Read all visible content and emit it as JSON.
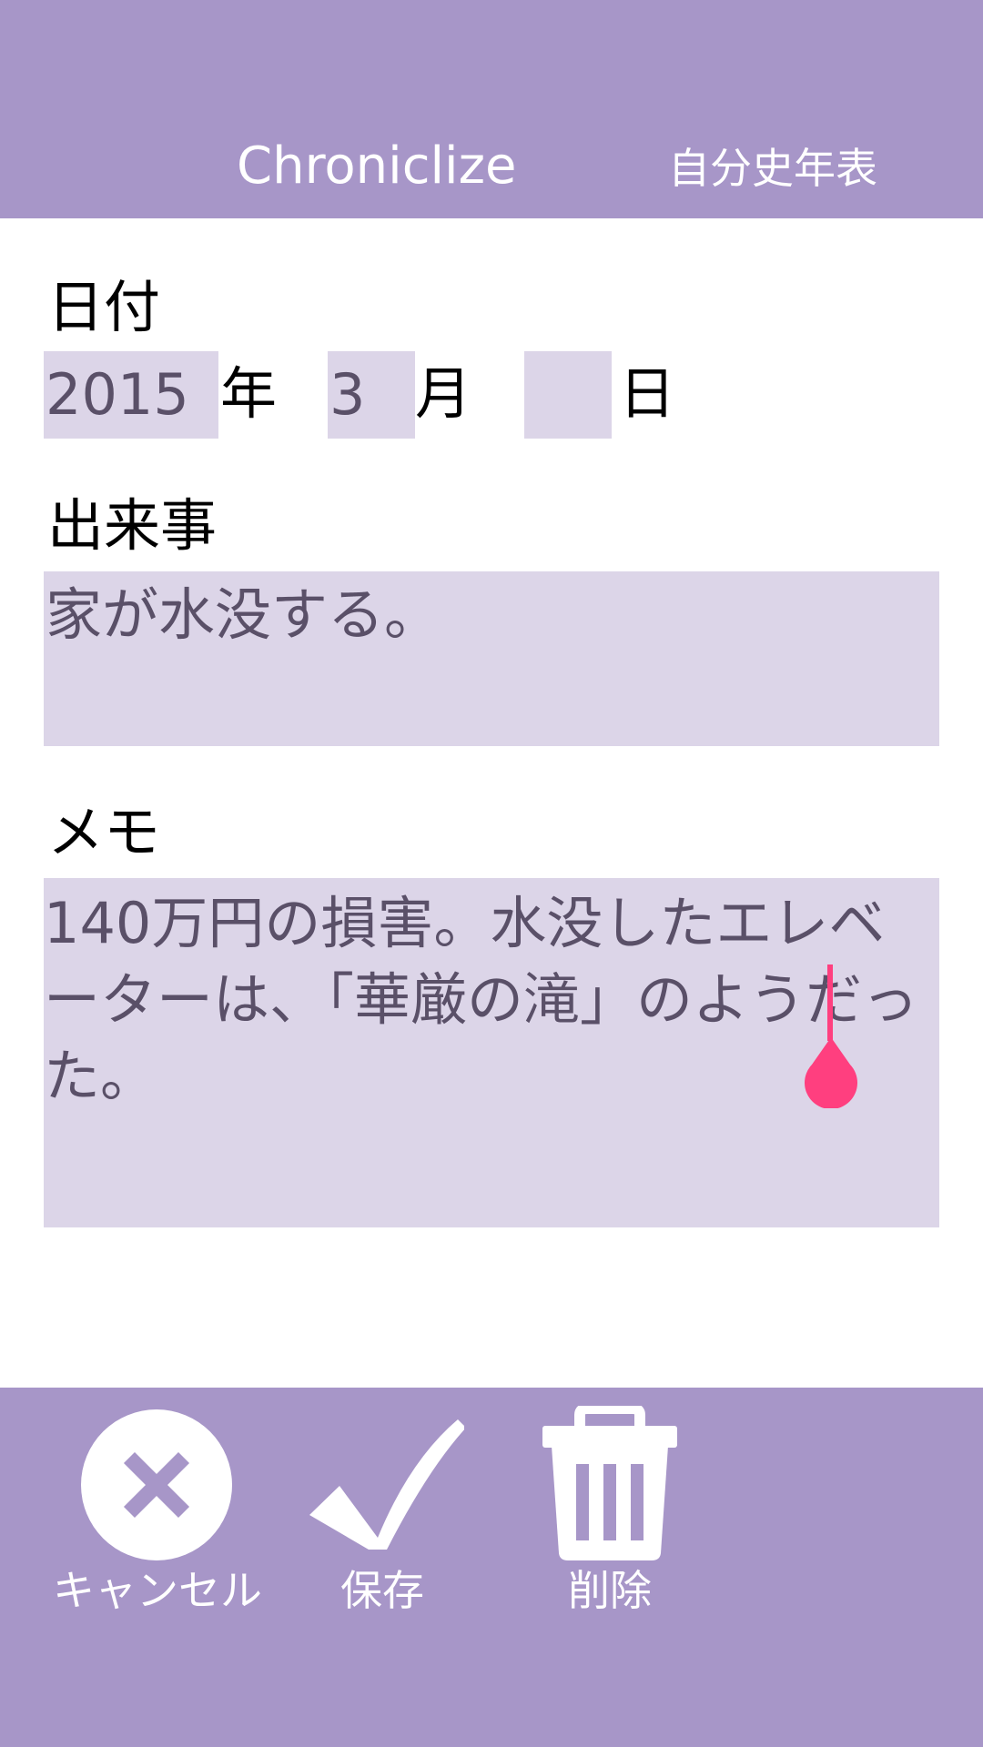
{
  "header": {
    "title": "Chroniclize",
    "subtitle": "自分史年表"
  },
  "date": {
    "label": "日付",
    "year_value": "2015",
    "year_unit": "年",
    "month_value": "3",
    "month_unit": "月",
    "day_value": "",
    "day_unit": "日"
  },
  "event": {
    "label": "出来事",
    "value": "家が水没する。"
  },
  "memo": {
    "label": "メモ",
    "value": "140万円の損害。水没したエレベーターは、「華厳の滝」のようだった。"
  },
  "actions": {
    "cancel": {
      "label": "キャンセル",
      "icon": "cancel-circle-x-icon"
    },
    "save": {
      "label": "保存",
      "icon": "checkmark-icon"
    },
    "delete": {
      "label": "削除",
      "icon": "trash-icon"
    }
  },
  "colors": {
    "theme": "#a796c8",
    "field_background": "#dcd5e8",
    "field_text": "#5a5068",
    "cursor": "#ff3f7f"
  }
}
